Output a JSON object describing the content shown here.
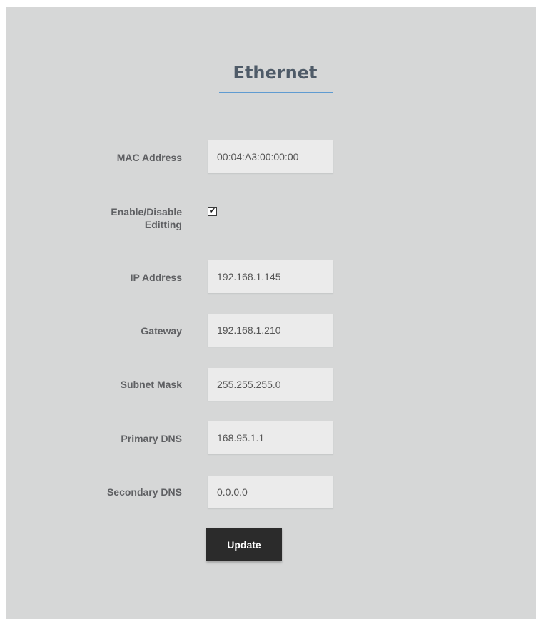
{
  "page": {
    "title": "Ethernet"
  },
  "form": {
    "mac_address": {
      "label": "MAC Address",
      "value": "00:04:A3:00:00:00"
    },
    "editing": {
      "label_line1": "Enable/Disable",
      "label_line2": "Editting",
      "checked": true,
      "check_glyph": "✔"
    },
    "ip_address": {
      "label": "IP Address",
      "value": "192.168.1.145"
    },
    "gateway": {
      "label": "Gateway",
      "value": "192.168.1.210"
    },
    "subnet_mask": {
      "label": "Subnet Mask",
      "value": "255.255.255.0"
    },
    "primary_dns": {
      "label": "Primary DNS",
      "value": "168.95.1.1"
    },
    "secondary_dns": {
      "label": "Secondary DNS",
      "value": "0.0.0.0"
    },
    "update_label": "Update"
  },
  "colors": {
    "panel_bg": "#d6d7d7",
    "title": "#4f5b68",
    "underline_accent": "#5f9bd1",
    "button_bg": "#2b2b2b",
    "field_bg": "#ebebeb"
  }
}
